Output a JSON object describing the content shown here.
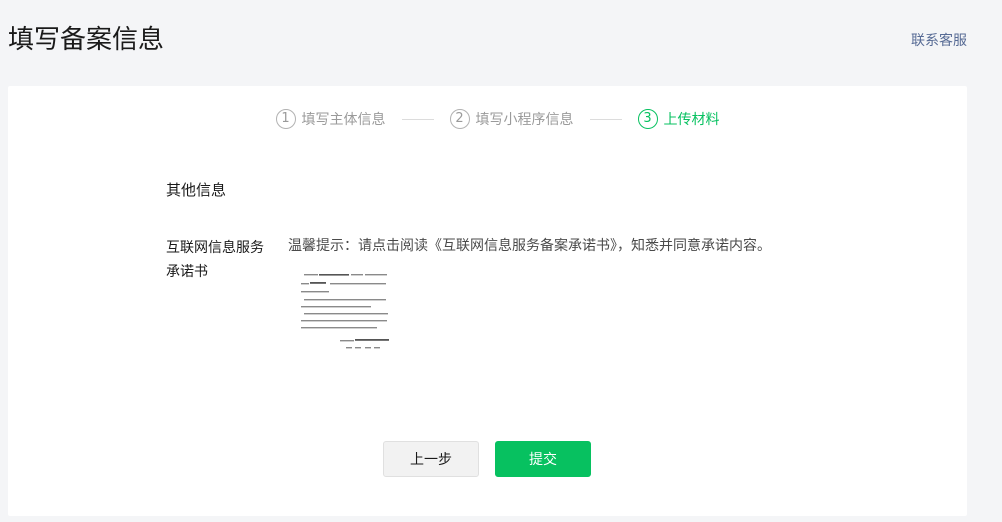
{
  "header": {
    "title": "填写备案信息",
    "contact_link": "联系客服"
  },
  "steps": [
    {
      "num": "1",
      "label": "填写主体信息",
      "state": "done"
    },
    {
      "num": "2",
      "label": "填写小程序信息",
      "state": "done"
    },
    {
      "num": "3",
      "label": "上传材料",
      "state": "active"
    }
  ],
  "form": {
    "section_title": "其他信息",
    "field": {
      "label_line1": "互联网信息服务",
      "label_line2": "承诺书",
      "hint": "温馨提示：请点击阅读《互联网信息服务备案承诺书》，知悉并同意承诺内容。"
    }
  },
  "actions": {
    "prev_label": "上一步",
    "submit_label": "提交"
  },
  "colors": {
    "accent": "#07c160",
    "link": "#576b95",
    "page_bg": "#f4f5f7"
  },
  "icons": {
    "document_preview": "document-thumbnail-icon"
  }
}
